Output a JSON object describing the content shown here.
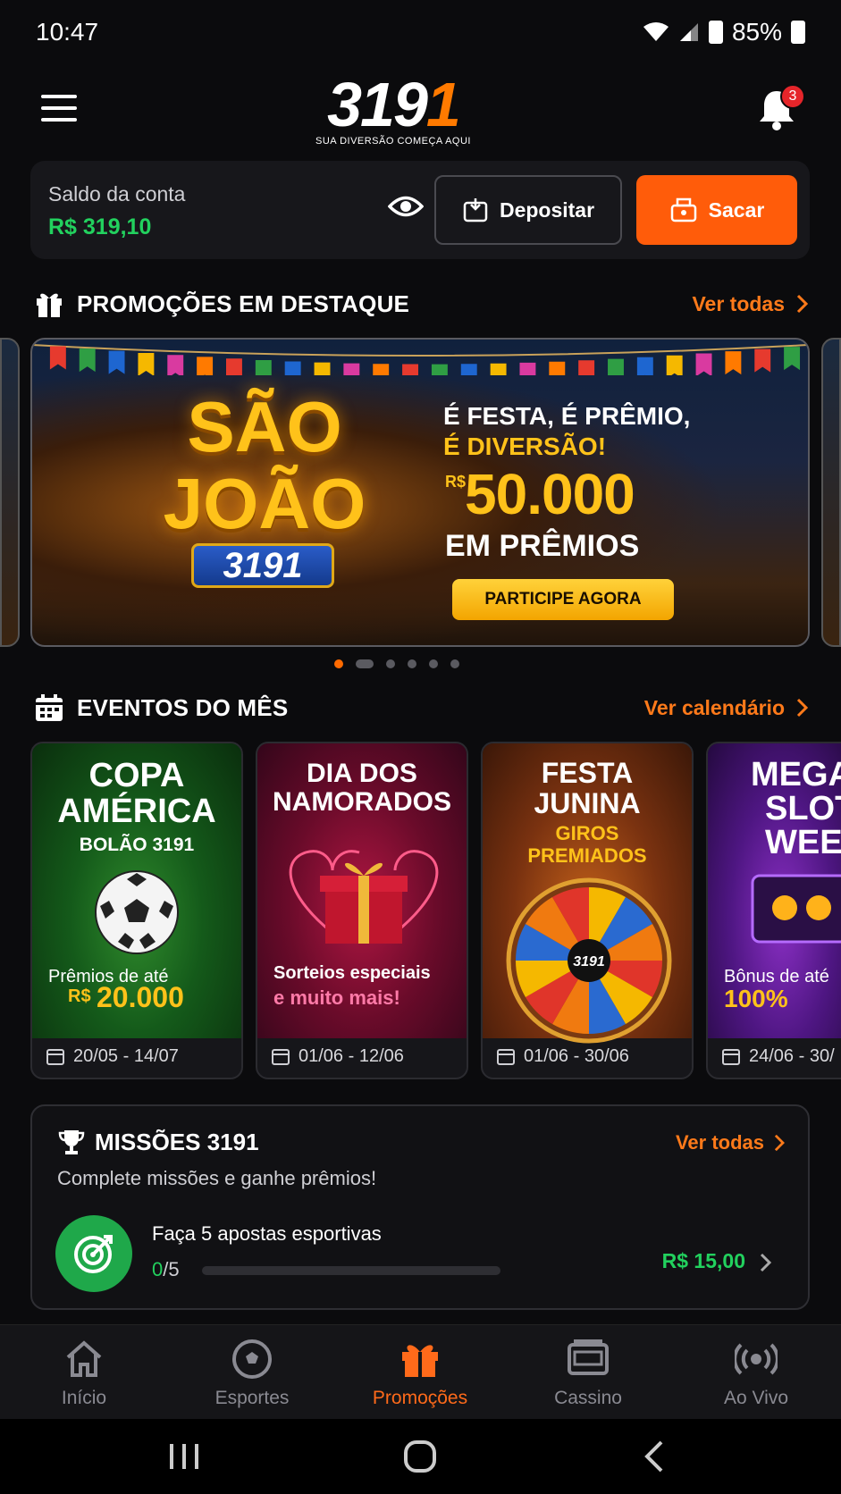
{
  "status_bar": {
    "time": "10:47",
    "battery": "85%"
  },
  "header": {
    "logo_text": "319",
    "logo_last": "1",
    "logo_tagline": "SUA DIVERSÃO COMEÇA AQUI",
    "notification_count": "3"
  },
  "balance": {
    "label": "Saldo da conta",
    "value": "R$ 319,10",
    "deposit_label": "Depositar",
    "withdraw_label": "Sacar"
  },
  "promos": {
    "title": "PROMOÇÕES EM DESTAQUE",
    "link": "Ver todas",
    "banner": {
      "headline_1": "SÃO",
      "headline_2": "JOÃO",
      "badge": "3191",
      "line1": "É FESTA, É PRÊMIO,",
      "line2": "É DIVERSÃO!",
      "currency": "R$",
      "amount": "50.000",
      "line3": "EM PRÊMIOS",
      "cta": "PARTICIPE AGORA"
    },
    "carousel_count": 6,
    "carousel_active": 0
  },
  "events": {
    "title": "EVENTOS DO MÊS",
    "link": "Ver calendário",
    "items": [
      {
        "title_1": "COPA",
        "title_2": "AMÉRICA",
        "subtitle": "BOLÃO 3191",
        "caption": "Prêmios de até",
        "highlight_prefix": "R$",
        "highlight": "20.000",
        "dates": "20/05 - 14/07"
      },
      {
        "title_1": "DIA DOS",
        "title_2": "NAMORADOS",
        "caption": "Sorteios especiais",
        "highlight": "e muito mais!",
        "dates": "01/06 - 12/06"
      },
      {
        "title_1": "FESTA",
        "title_2": "JUNINA",
        "subtitle_1": "GIROS",
        "subtitle_2": "PREMIADOS",
        "wheel_label": "3191",
        "dates": "01/06 - 30/06"
      },
      {
        "title_1": "MEGA",
        "title_2": "SLOT",
        "title_3": "WEE",
        "caption": "Bônus de até",
        "highlight": "100%",
        "dates": "24/06 - 30/"
      }
    ]
  },
  "missions": {
    "title": "MISSÕES 3191",
    "link": "Ver todas",
    "description": "Complete missões e ganhe prêmios!",
    "item": {
      "name": "Faça 5 apostas esportivas",
      "done": "0",
      "total": "/5",
      "progress": 0,
      "reward": "R$ 15,00"
    }
  },
  "bottom_nav": [
    {
      "label": "Início",
      "icon": "home-icon"
    },
    {
      "label": "Esportes",
      "icon": "soccer-ball-icon"
    },
    {
      "label": "Promoções",
      "icon": "gift-icon",
      "active": true
    },
    {
      "label": "Cassino",
      "icon": "slot-machine-icon"
    },
    {
      "label": "Ao Vivo",
      "icon": "live-broadcast-icon"
    }
  ],
  "colors": {
    "accent": "#ff5c0a",
    "positive": "#22d15e",
    "gold": "#ffc21a"
  }
}
